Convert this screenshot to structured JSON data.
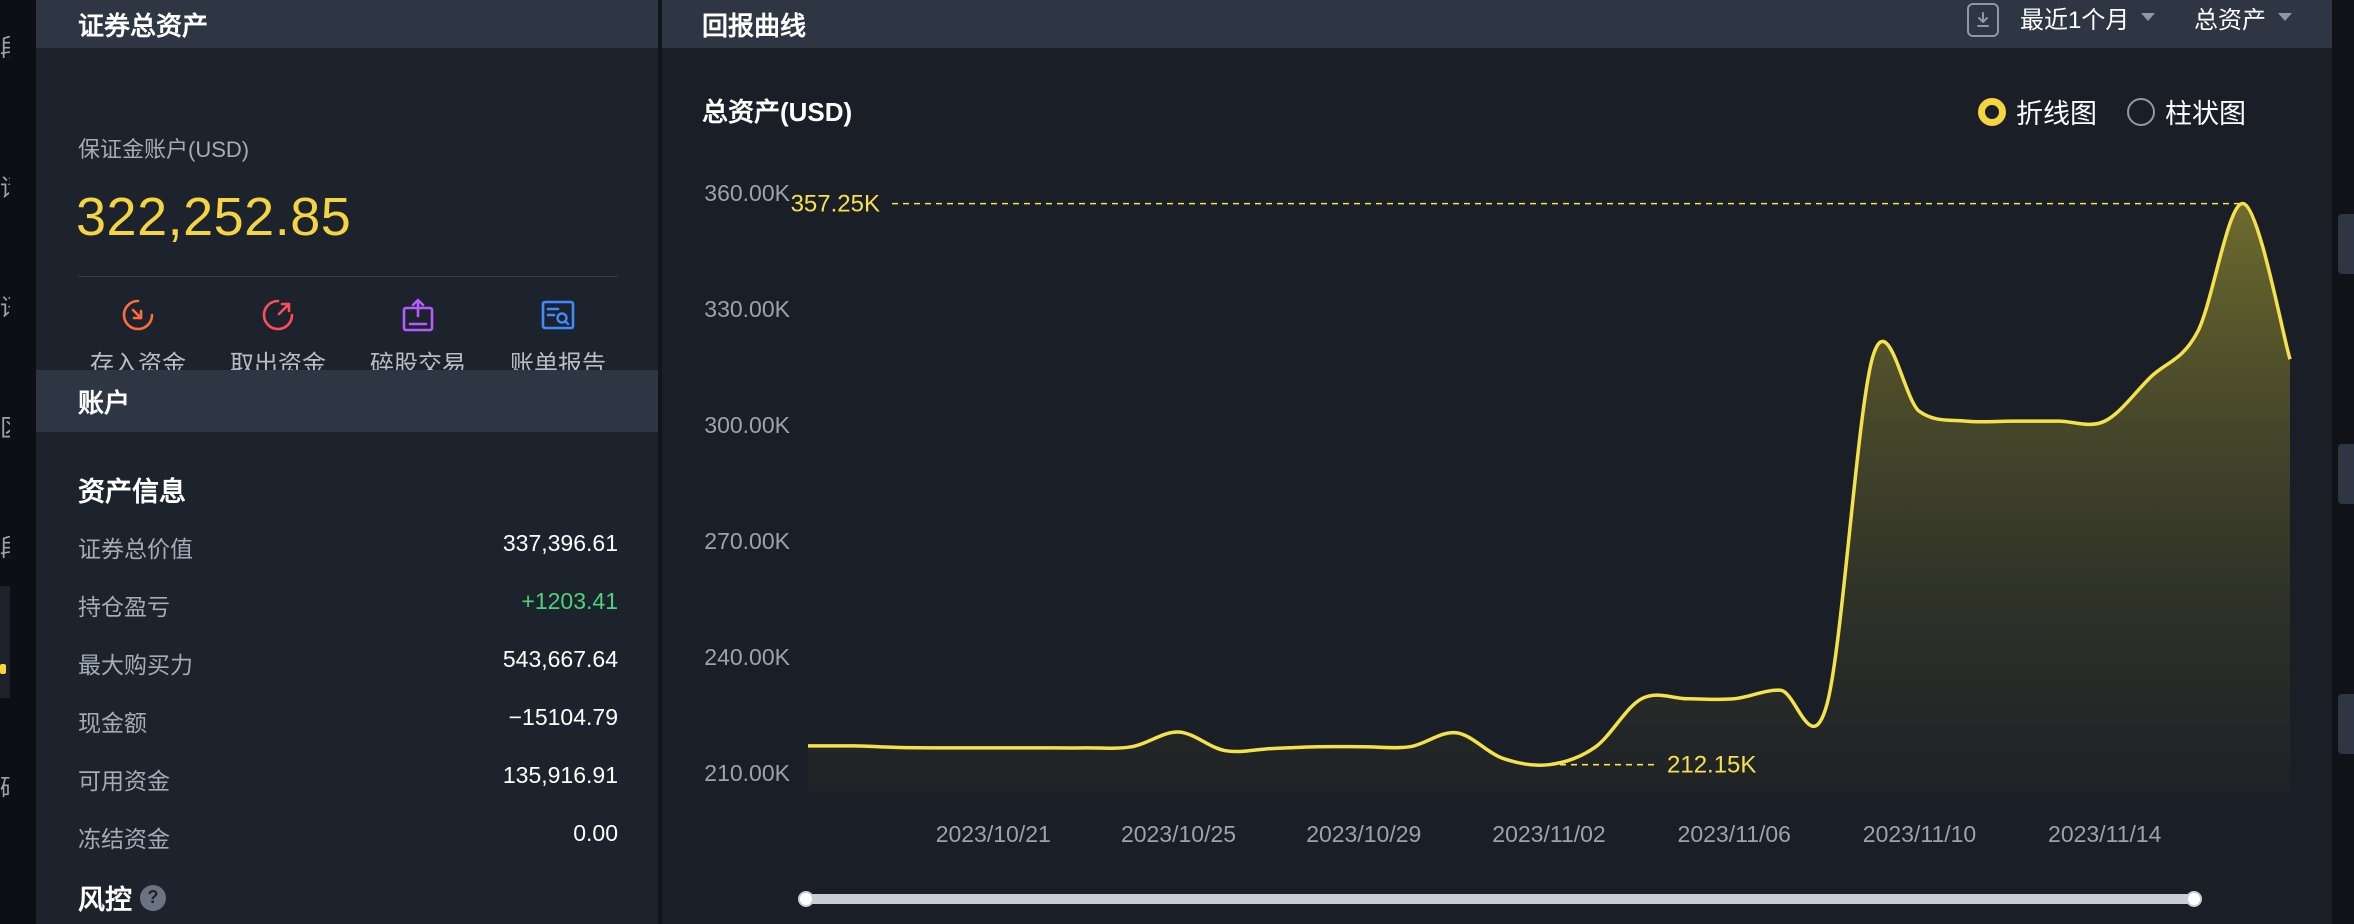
{
  "left_rail": {
    "glyphs": [
      "段",
      "请",
      "讯",
      "区",
      "段",
      "码"
    ]
  },
  "assets": {
    "header": "证券总资产",
    "account_label": "保证金账户(USD)",
    "account_value": "322,252.85",
    "actions": [
      {
        "label": "存入资金",
        "icon": "deposit-icon",
        "color": "#ff6b3d"
      },
      {
        "label": "取出资金",
        "icon": "withdraw-icon",
        "color": "#ff4d5a"
      },
      {
        "label": "碎股交易",
        "icon": "fractional-trade-icon",
        "color": "#b55cff"
      },
      {
        "label": "账单报告",
        "icon": "statement-icon",
        "color": "#3d8bff"
      }
    ]
  },
  "account": {
    "header": "账户",
    "section_title": "资产信息",
    "rows": [
      {
        "label": "证券总价值",
        "value": "337,396.61"
      },
      {
        "label": "持仓盈亏",
        "value": "+1203.41"
      },
      {
        "label": "最大购买力",
        "value": "543,667.64"
      },
      {
        "label": "现金额",
        "value": "−15104.79"
      },
      {
        "label": "可用资金",
        "value": "135,916.91"
      },
      {
        "label": "冻结资金",
        "value": "0.00"
      }
    ],
    "risk_title": "风控",
    "help_glyph": "?"
  },
  "returns": {
    "header": "回报曲线",
    "period": "最近1个月",
    "metric": "总资产",
    "chart_title": "总资产(USD)",
    "view_line": "折线图",
    "view_bar": "柱状图",
    "selected_view": "折线图"
  },
  "chart_data": {
    "type": "area",
    "title": "总资产(USD)",
    "x": [
      "2023/10/17",
      "2023/10/18",
      "2023/10/19",
      "2023/10/20",
      "2023/10/21",
      "2023/10/22",
      "2023/10/23",
      "2023/10/24",
      "2023/10/25",
      "2023/10/26",
      "2023/10/27",
      "2023/10/28",
      "2023/10/29",
      "2023/10/30",
      "2023/10/31",
      "2023/11/01",
      "2023/11/02",
      "2023/11/03",
      "2023/11/04",
      "2023/11/05",
      "2023/11/06",
      "2023/11/07",
      "2023/11/08",
      "2023/11/09",
      "2023/11/10",
      "2023/11/11",
      "2023/11/12",
      "2023/11/13",
      "2023/11/14",
      "2023/11/15",
      "2023/11/16",
      "2023/11/17"
    ],
    "values": [
      217.0,
      217.0,
      216.6,
      216.5,
      216.5,
      216.5,
      216.5,
      216.8,
      220.6,
      215.8,
      216.3,
      216.8,
      216.8,
      216.8,
      220.4,
      213.8,
      212.15,
      216.7,
      229.2,
      229.2,
      229.2,
      231.4,
      227.7,
      318.0,
      303.5,
      301.0,
      301.0,
      301.0,
      301.0,
      312.5,
      324.0,
      357.25,
      317.0
    ],
    "x_ticks": [
      "2023/10/21",
      "2023/10/25",
      "2023/10/29",
      "2023/11/02",
      "2023/11/06",
      "2023/11/10",
      "2023/11/14"
    ],
    "y_ticks": [
      "210.00K",
      "240.00K",
      "270.00K",
      "300.00K",
      "330.00K",
      "360.00K"
    ],
    "ylim": [
      210,
      360
    ],
    "unit": "K",
    "max_label": "357.25K",
    "min_label": "212.15K",
    "line_color": "#f5e24a"
  }
}
